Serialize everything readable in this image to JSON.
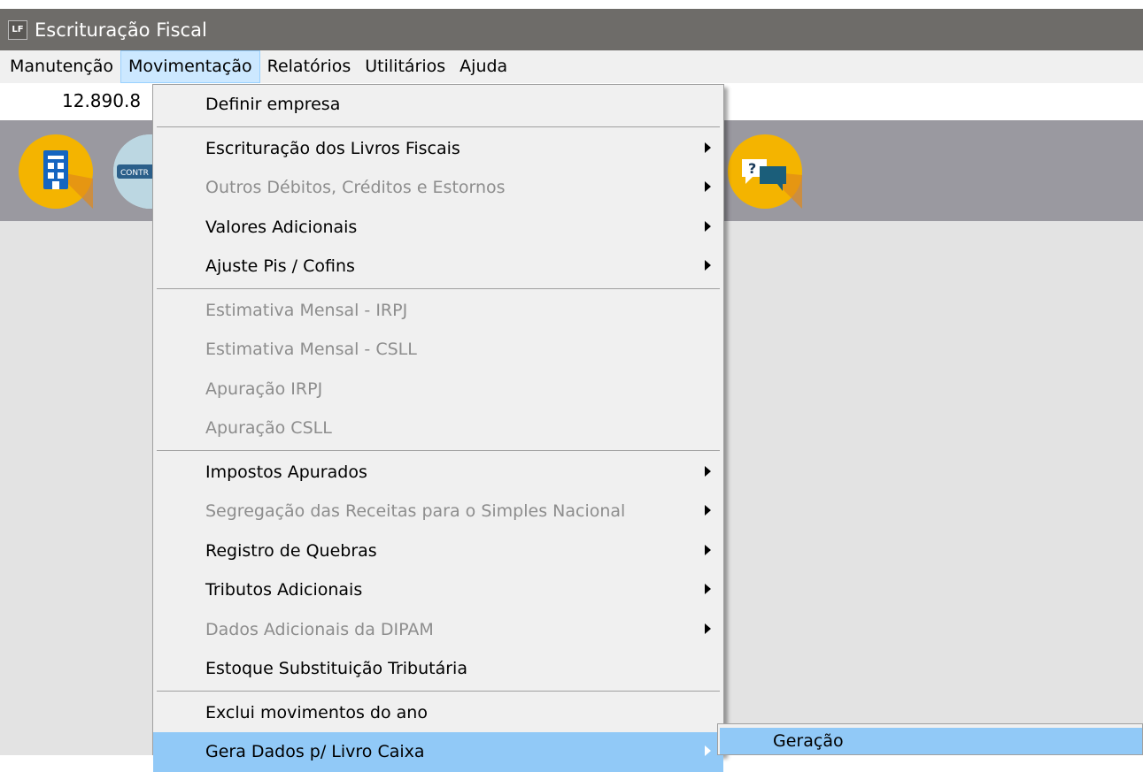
{
  "window": {
    "title": "Escrituração Fiscal",
    "app_badge": "LF"
  },
  "menubar": [
    "Manutenção",
    "Movimentação",
    "Relatórios",
    "Utilitários",
    "Ajuda"
  ],
  "company": {
    "code": "12.890.8"
  },
  "toolbar": {
    "building_color": "#f4b400",
    "help_color": "#f4b400",
    "badge_text": "CONTR"
  },
  "dropdown": {
    "items": [
      {
        "label": "Definir empresa",
        "enabled": true,
        "submenu": false
      },
      {
        "label": "Escrituração dos Livros Fiscais",
        "enabled": true,
        "submenu": true
      },
      {
        "label": "Outros Débitos, Créditos e Estornos",
        "enabled": false,
        "submenu": true
      },
      {
        "label": "Valores Adicionais",
        "enabled": true,
        "submenu": true
      },
      {
        "label": "Ajuste Pis / Cofins",
        "enabled": true,
        "submenu": true
      },
      {
        "label": "Estimativa Mensal - IRPJ",
        "enabled": false,
        "submenu": false
      },
      {
        "label": "Estimativa Mensal - CSLL",
        "enabled": false,
        "submenu": false
      },
      {
        "label": "Apuração IRPJ",
        "enabled": false,
        "submenu": false
      },
      {
        "label": "Apuração CSLL",
        "enabled": false,
        "submenu": false
      },
      {
        "label": "Impostos Apurados",
        "enabled": true,
        "submenu": true
      },
      {
        "label": "Segregação das Receitas para o Simples Nacional",
        "enabled": false,
        "submenu": true
      },
      {
        "label": "Registro de Quebras",
        "enabled": true,
        "submenu": true
      },
      {
        "label": "Tributos Adicionais",
        "enabled": true,
        "submenu": true
      },
      {
        "label": "Dados Adicionais da DIPAM",
        "enabled": false,
        "submenu": true
      },
      {
        "label": "Estoque Substituição Tributária",
        "enabled": true,
        "submenu": false
      },
      {
        "label": "Exclui movimentos do ano",
        "enabled": true,
        "submenu": false
      },
      {
        "label": "Gera Dados p/ Livro Caixa",
        "enabled": true,
        "submenu": true,
        "highlighted": true
      }
    ]
  },
  "submenu": {
    "items": [
      "Geração"
    ]
  },
  "colors": {
    "highlight": "#91c9f7",
    "menu_bg": "#f0f0f0",
    "disabled_text": "#8d8d8d"
  }
}
